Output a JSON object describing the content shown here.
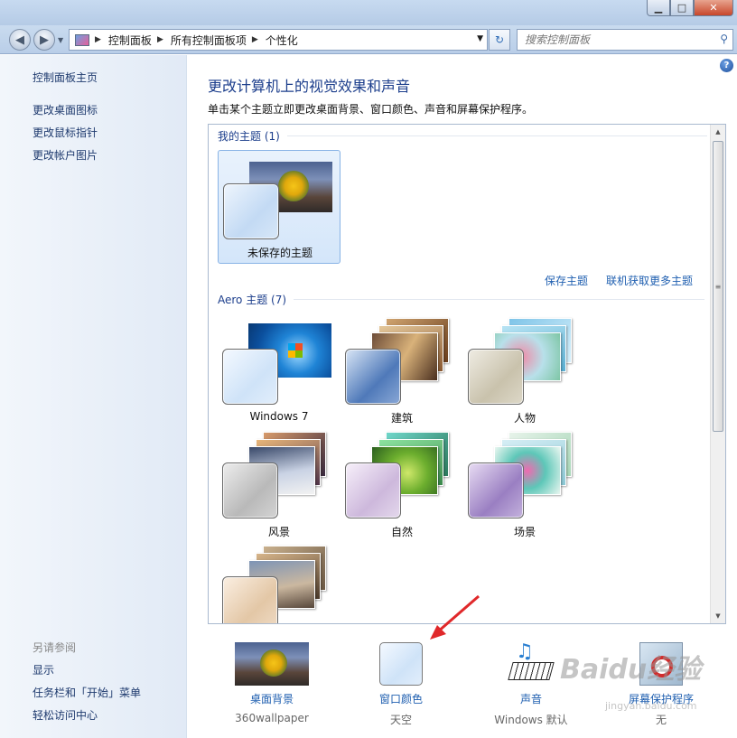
{
  "window": {
    "min_icon": "minimize-icon",
    "max_icon": "maximize-icon",
    "close_icon": "close-icon"
  },
  "address": {
    "crumbs": [
      "控制面板",
      "所有控制面板项",
      "个性化"
    ],
    "search_placeholder": "搜索控制面板"
  },
  "sidebar": {
    "home": "控制面板主页",
    "links": [
      "更改桌面图标",
      "更改鼠标指针",
      "更改帐户图片"
    ],
    "see_also_title": "另请参阅",
    "see_also": [
      "显示",
      "任务栏和「开始」菜单",
      "轻松访问中心"
    ]
  },
  "main": {
    "title": "更改计算机上的视觉效果和声音",
    "subtitle": "单击某个主题立即更改桌面背景、窗口颜色、声音和屏幕保护程序。",
    "my_themes_header": "我的主题 (1)",
    "my_themes": [
      {
        "label": "未保存的主题",
        "selected": true
      }
    ],
    "save_theme": "保存主题",
    "get_more": "联机获取更多主题",
    "aero_header": "Aero 主题 (7)",
    "aero_themes": [
      {
        "label": "Windows 7"
      },
      {
        "label": "建筑"
      },
      {
        "label": "人物"
      },
      {
        "label": "风景"
      },
      {
        "label": "自然"
      },
      {
        "label": "场景"
      },
      {
        "label": ""
      }
    ]
  },
  "bottom": {
    "items": [
      {
        "caption": "桌面背景",
        "value": "360wallpaper"
      },
      {
        "caption": "窗口颜色",
        "value": "天空"
      },
      {
        "caption": "声音",
        "value": "Windows 默认"
      },
      {
        "caption": "屏幕保护程序",
        "value": "无"
      }
    ]
  },
  "watermark": {
    "brand": "Baidu经验",
    "url": "jingyan.baidu.com"
  },
  "colors": {
    "link": "#1f5fb0",
    "title": "#1c3e8c",
    "selection": "#d4e6fa",
    "annotation_arrow": "#e0282a"
  }
}
